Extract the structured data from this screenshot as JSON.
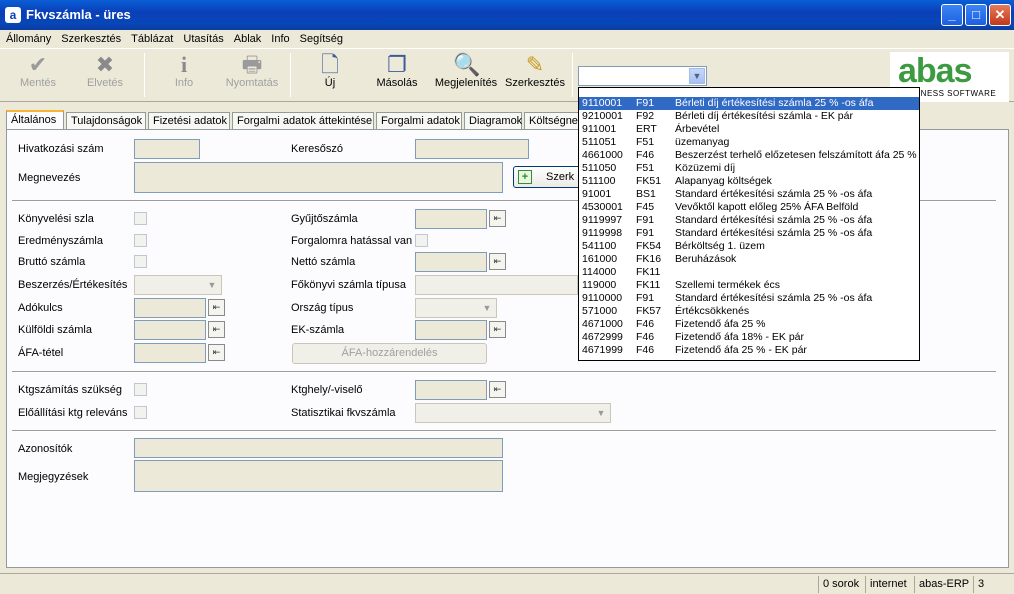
{
  "window": {
    "title": "Fkvszámla - üres"
  },
  "menu": [
    "Állomány",
    "Szerkesztés",
    "Táblázat",
    "Utasítás",
    "Ablak",
    "Info",
    "Segítség"
  ],
  "toolbar": {
    "buttons": [
      {
        "label": "Mentés",
        "icon": "check-icon",
        "enabled": false
      },
      {
        "label": "Elvetés",
        "icon": "x-icon",
        "enabled": false
      },
      {
        "label": "Info",
        "icon": "info-icon",
        "enabled": false
      },
      {
        "label": "Nyomtatás",
        "icon": "printer-icon",
        "enabled": false
      },
      {
        "label": "Új",
        "icon": "new-document-icon",
        "enabled": true
      },
      {
        "label": "Másolás",
        "icon": "copy-icon",
        "enabled": true
      },
      {
        "label": "Megjelenítés",
        "icon": "magnifier-icon",
        "enabled": true
      },
      {
        "label": "Szerkesztés",
        "icon": "edit-icon",
        "enabled": true
      }
    ],
    "combo_value": ""
  },
  "logo": {
    "text": "abas",
    "tagline": "BUSINESS SOFTWARE"
  },
  "tabs": [
    "Általános",
    "Tulajdonságok",
    "Fizetési adatok",
    "Forgalmi adatok áttekintése",
    "Forgalmi adatok",
    "Diagramok",
    "Költségnem"
  ],
  "form": {
    "hivatkozasi_szam": "Hivatkozási szám",
    "keresoszo": "Keresőszó",
    "megnevezes": "Megnevezés",
    "szerk_button": "Szerk",
    "konyvelesi_szla": "Könyvelési szla",
    "gyujtoszamla": "Gyűjtőszámla",
    "eredmenyszamla": "Eredményszámla",
    "forgalomra": "Forgalomra hatással van",
    "brutto_szamla": "Bruttó számla",
    "netto_szamla": "Nettó számla",
    "beszerzes": "Beszerzés/Értékesítés",
    "fokonyvi_tipus": "Főkönyvi számla típusa",
    "adokulcs": "Adókulcs",
    "orszag_tipus": "Ország típus",
    "kulfoldi_szamla": "Külföldi számla",
    "ek_szamla": "EK-számla",
    "afa_tetel": "ÁFA-tétel",
    "afa_button": "ÁFA-hozzárendelés",
    "ktgszamitas": "Ktgszámítás szükség",
    "ktghely": "Ktghely/-viselő",
    "eloallitasi": "Előállítási ktg releváns",
    "statisztikai": "Statisztikai fkvszámla",
    "azonositok": "Azonosítók",
    "megjegyzesek": "Megjegyzések"
  },
  "dropdown": [
    {
      "code": "9110001",
      "type": "F91",
      "desc": "Bérleti díj értékesítési számla 25 % -os áfa",
      "selected": true
    },
    {
      "code": "9210001",
      "type": "F92",
      "desc": "Bérleti díj értékesítési számla - EK pár"
    },
    {
      "code": "911001",
      "type": "ERT",
      "desc": "Árbevétel"
    },
    {
      "code": "511051",
      "type": "F51",
      "desc": "üzemanyag"
    },
    {
      "code": "4661000",
      "type": "F46",
      "desc": "Beszerzést terhelő előzetesen felszámított áfa 25 %"
    },
    {
      "code": "511050",
      "type": "F51",
      "desc": "Közüzemi díj"
    },
    {
      "code": "511100",
      "type": "FK51",
      "desc": "Alapanyag költségek"
    },
    {
      "code": "91001",
      "type": "BS1",
      "desc": "Standard értékesítési számla 25 % -os áfa"
    },
    {
      "code": "4530001",
      "type": "F45",
      "desc": "Vevőktől kapott előleg  25% ÁFA Belföld"
    },
    {
      "code": "9119997",
      "type": "F91",
      "desc": "Standard értékesítési számla 25 % -os áfa"
    },
    {
      "code": "9119998",
      "type": "F91",
      "desc": "Standard értékesítési számla 25 % -os áfa"
    },
    {
      "code": "541100",
      "type": "FK54",
      "desc": "Bérköltség 1. üzem"
    },
    {
      "code": "161000",
      "type": "FK16",
      "desc": "Beruházások"
    },
    {
      "code": "114000",
      "type": "FK11",
      "desc": ""
    },
    {
      "code": "119000",
      "type": "FK11",
      "desc": "Szellemi termékek écs"
    },
    {
      "code": "9110000",
      "type": "F91",
      "desc": "Standard értékesítési számla 25 % -os áfa"
    },
    {
      "code": "571000",
      "type": "FK57",
      "desc": "Értékcsökkenés"
    },
    {
      "code": "4671000",
      "type": "F46",
      "desc": "Fizetendő áfa 25 %"
    },
    {
      "code": "4672999",
      "type": "F46",
      "desc": "Fizetendő áfa  18% - EK pár"
    },
    {
      "code": "4671999",
      "type": "F46",
      "desc": "Fizetendő áfa 25 % - EK pár"
    }
  ],
  "status": {
    "rows": "0 sorok",
    "conn": "internet",
    "app": "abas-ERP",
    "num": "3"
  }
}
